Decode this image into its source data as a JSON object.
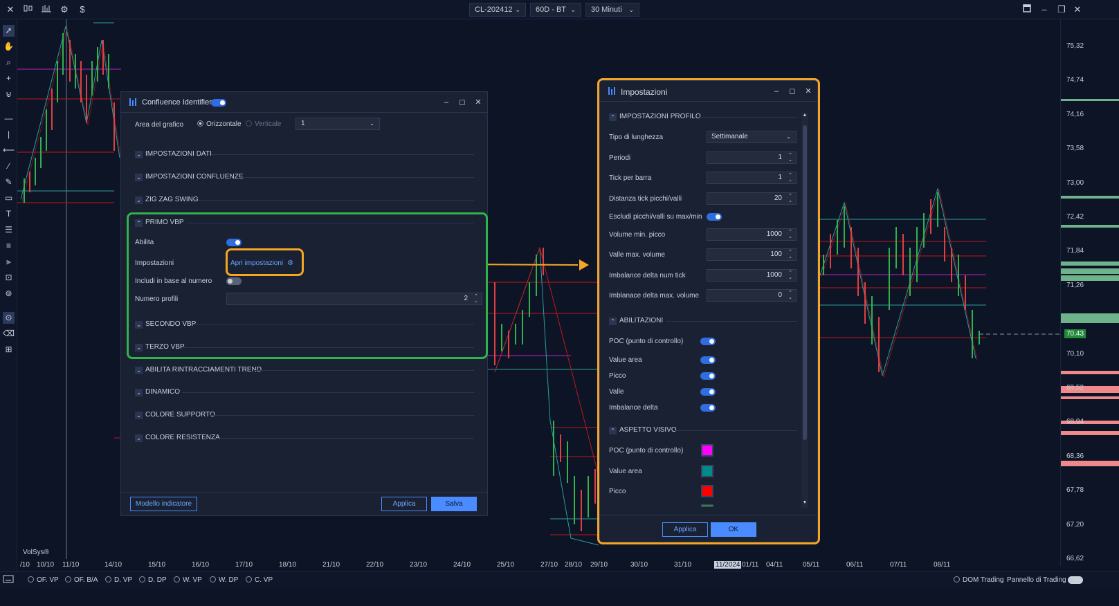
{
  "topbar": {
    "close": "✕",
    "symbol": "CL-202412",
    "timeframe": "60D - BT",
    "interval": "30 Minuti"
  },
  "price_axis": [
    "75,32",
    "74,74",
    "74,16",
    "73,58",
    "73,00",
    "72,42",
    "71,84",
    "71,26",
    "70,43",
    "70,10",
    "69,52",
    "68,94",
    "68,36",
    "67,78",
    "67,20",
    "66,62"
  ],
  "time_axis": [
    "/10",
    "10/10",
    "11/10",
    "14/10",
    "15/10",
    "16/10",
    "17/10",
    "18/10",
    "21/10",
    "22/10",
    "23/10",
    "24/10",
    "25/10",
    "27/10",
    "28/10",
    "29/10",
    "30/10",
    "31/10",
    "11/2024",
    "01/11",
    "04/11",
    "05/11",
    "06/11",
    "07/11",
    "08/11"
  ],
  "watermark": "VolSys®",
  "bottombar": {
    "items": [
      "OF. VP",
      "OF. B/A",
      "D. VP",
      "D. DP",
      "W. VP",
      "W. DP",
      "C. VP"
    ],
    "dom": "DOM Trading",
    "panel": "Pannello di Trading"
  },
  "confluence": {
    "title": "Confluence Identifier",
    "area_label": "Area del grafico",
    "orient_h": "Orizzontale",
    "orient_v": "Verticale",
    "area_value": "1",
    "sections_top": [
      "IMPOSTAZIONI DATI",
      "IMPOSTAZIONI CONFLUENZE",
      "ZIG ZAG SWING"
    ],
    "primo": {
      "title": "PRIMO VBP",
      "abilita": "Abilita",
      "impostazioni": "Impostazioni",
      "link": "Apri impostazioni",
      "includi": "Includi in base al numero",
      "numero": "Numero profili",
      "numero_value": "2",
      "secondo": "SECONDO VBP",
      "terzo": "TERZO VBP"
    },
    "sections_bottom": [
      "ABILITA RINTRACCIAMENTI TREND",
      "DINAMICO",
      "COLORE SUPPORTO",
      "COLORE RESISTENZA"
    ],
    "btn_model": "Modello indicatore",
    "btn_apply": "Applica",
    "btn_save": "Salva"
  },
  "settings": {
    "title": "Impostazioni",
    "profilo": "IMPOSTAZIONI PROFILO",
    "fields": [
      {
        "label": "Tipo di lunghezza",
        "value": "Settimanale"
      },
      {
        "label": "Periodi",
        "value": "1"
      },
      {
        "label": "Tick per barra",
        "value": "1"
      },
      {
        "label": "Distanza tick picchi/valli",
        "value": "20"
      },
      {
        "label": "Escludi picchi/valli su max/min",
        "value": ""
      },
      {
        "label": "Volume min. picco",
        "value": "1000"
      },
      {
        "label": "Valle max. volume",
        "value": "100"
      },
      {
        "label": "Imbalance delta num tick",
        "value": "1000"
      },
      {
        "label": "Imblanace delta max. volume",
        "value": "0"
      }
    ],
    "abilitazioni": "ABILITAZIONI",
    "toggles": [
      "POC (punto di controllo)",
      "Value area",
      "Picco",
      "Valle",
      "Imbalance delta"
    ],
    "aspetto": "ASPETTO VISIVO",
    "colors": [
      {
        "label": "POC (punto di controllo)",
        "color": "#ff00ff"
      },
      {
        "label": "Value area",
        "color": "#008b8b"
      },
      {
        "label": "Picco",
        "color": "#ff0000"
      }
    ],
    "btn_apply": "Applica",
    "btn_ok": "OK"
  }
}
